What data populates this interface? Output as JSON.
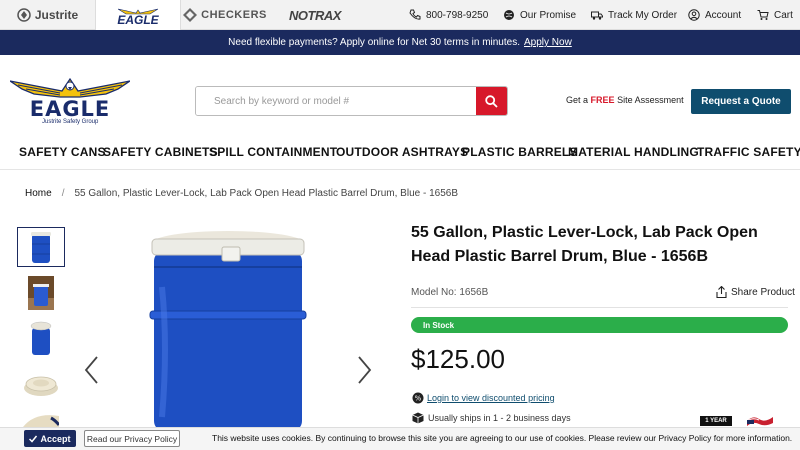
{
  "brands": {
    "justrite": "Justrite",
    "eagle": "EAGLE",
    "checkers": "CHECKERS",
    "notrax": "NOTRAX"
  },
  "utility": {
    "phone": "800-798-9250",
    "promise": "Our Promise",
    "track": "Track My Order",
    "account": "Account",
    "cart": "Cart"
  },
  "promo": {
    "text": "Need flexible payments? Apply online for Net 30 terms in minutes.",
    "link": "Apply Now"
  },
  "header": {
    "logo_text": "EAGLE",
    "logo_sub": "Justrite Safety Group",
    "search_placeholder": "Search by keyword or model #",
    "assess_pre": "Get a",
    "assess_free": "FREE",
    "assess_post": "Site Assessment",
    "quote": "Request a Quote"
  },
  "nav": [
    "SAFETY CANS",
    "SAFETY CABINETS",
    "SPILL CONTAINMENT",
    "OUTDOOR ASHTRAYS",
    "PLASTIC BARRELS",
    "MATERIAL HANDLING",
    "TRAFFIC SAFETY"
  ],
  "breadcrumb": {
    "home": "Home",
    "separator": "/",
    "current": "55 Gallon, Plastic Lever-Lock, Lab Pack Open Head Plastic Barrel Drum, Blue - 1656B"
  },
  "product": {
    "title": "55 Gallon, Plastic Lever-Lock, Lab Pack Open Head Plastic Barrel Drum, Blue - 1656B",
    "model": "Model No: 1656B",
    "share": "Share Product",
    "stock": "In Stock",
    "price": "$125.00",
    "login_pricing": "Login to view discounted pricing",
    "ships": "Usually ships in 1 - 2 business days",
    "warranty_badge": "1 YEAR"
  },
  "cookie": {
    "accept": "Accept",
    "privacy": "Read our Privacy Policy",
    "message": "This website uses cookies. By continuing to browse this site you are agreeing to our use of cookies. Please review our Privacy Policy for more information."
  },
  "colors": {
    "navy": "#1b2a5e",
    "red": "#d7182a",
    "teal": "#0f4d6e",
    "green": "#2bae4a",
    "drum_blue": "#1e4fc2"
  }
}
